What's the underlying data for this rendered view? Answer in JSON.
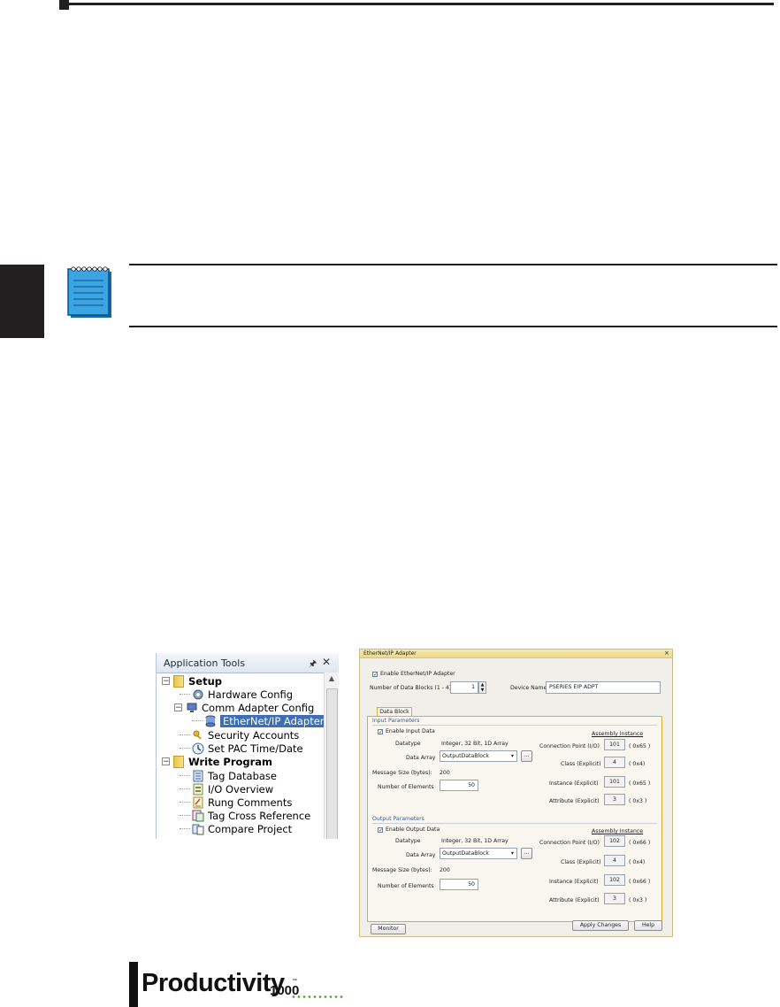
{
  "app_tools": {
    "title": "Application Tools",
    "pin_glyph": "ᵖ",
    "close_glyph": "✕",
    "tree": [
      {
        "label": "Setup",
        "bold": true
      },
      {
        "label": "Hardware Config"
      },
      {
        "label": "Comm Adapter Config"
      },
      {
        "label": "EtherNet/IP Adapter",
        "selected": true
      },
      {
        "label": "Security Accounts"
      },
      {
        "label": "Set PAC Time/Date"
      },
      {
        "label": "Write Program",
        "bold": true
      },
      {
        "label": "Tag Database"
      },
      {
        "label": "I/O Overview"
      },
      {
        "label": "Rung Comments"
      },
      {
        "label": "Tag Cross Reference"
      },
      {
        "label": "Compare Project"
      }
    ]
  },
  "dialog": {
    "title": "EtherNet/IP Adapter",
    "close": "×",
    "enable_adapter": "Enable EtherNet/IP Adapter",
    "num_blocks_label": "Number of Data Blocks (1 - 4)",
    "num_blocks_value": "1",
    "device_name_label": "Device Name",
    "device_name_value": "PSERIES EIP ADPT",
    "tab_label": "Data Block 1",
    "input": {
      "group_label": "Input Parameters",
      "enable_label": "Enable Input Data",
      "datatype_label": "Datatype",
      "datatype_value": "Integer, 32 Bit, 1D Array",
      "data_array_label": "Data Array",
      "data_array_value": "OutputDataBlock",
      "browse": "...",
      "msg_size_label": "Message Size (bytes):",
      "msg_size_value": "200",
      "num_elements_label": "Number of Elements",
      "num_elements_value": "50",
      "assembly_heading": "Assembly Instance",
      "conn_point_label": "Connection Point (I/O)",
      "conn_point_value": "101",
      "conn_point_hex": "( 0x65 )",
      "class_label": "Class (Explicit)",
      "class_value": "4",
      "class_hex": "( 0x4)",
      "instance_label": "Instance (Explicit)",
      "instance_value": "101",
      "instance_hex": "( 0x65 )",
      "attribute_label": "Attribute (Explicit)",
      "attribute_value": "3",
      "attribute_hex": "( 0x3 )"
    },
    "output": {
      "group_label": "Output Parameters",
      "enable_label": "Enable Output Data",
      "datatype_label": "Datatype",
      "datatype_value": "Integer, 32 Bit, 1D Array",
      "data_array_label": "Data Array",
      "data_array_value": "OutputDataBlock",
      "browse": "...",
      "msg_size_label": "Message Size (bytes):",
      "msg_size_value": "200",
      "num_elements_label": "Number of Elements",
      "num_elements_value": "50",
      "assembly_heading": "Assembly Instance",
      "conn_point_label": "Connection Point (I/O)",
      "conn_point_value": "102",
      "conn_point_hex": "( 0x66 )",
      "class_label": "Class (Explicit)",
      "class_value": "4",
      "class_hex": "( 0x4)",
      "instance_label": "Instance (Explicit)",
      "instance_value": "102",
      "instance_hex": "( 0x66 )",
      "attribute_label": "Attribute (Explicit)",
      "attribute_value": "3",
      "attribute_hex": "( 0x3 )"
    },
    "monitor_button": "Monitor",
    "apply_button": "Apply Changes",
    "help_button": "Help"
  },
  "logo": {
    "text": "Productivity",
    "sub": "1000",
    "tm": "™"
  },
  "colors": {
    "rule": "#231f20",
    "note_icon": "#1c8fd0",
    "selection": "#3c6fb5",
    "dialog_frame": "#e1a93c",
    "logo_dots": "#5aa832"
  }
}
